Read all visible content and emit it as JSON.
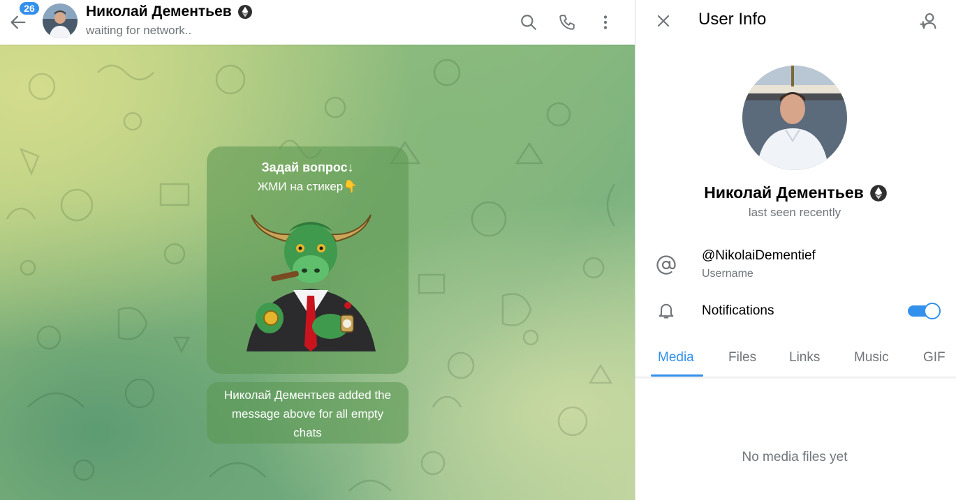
{
  "chat_header": {
    "unread_badge": "26",
    "contact_name": "Николай Дементьев",
    "status": "waiting for network.."
  },
  "pinned_message": {
    "line1": "Задай вопрос↓",
    "line2": "ЖМИ на стикер👇"
  },
  "service_message": "Николай Дементьев added the message above for all empty chats",
  "user_info": {
    "title": "User Info",
    "name": "Николай Дементьев",
    "last_seen": "last seen recently",
    "username": "@NikolaiDementief",
    "username_label": "Username",
    "notifications_label": "Notifications",
    "notifications_enabled": true,
    "tabs": [
      "Media",
      "Files",
      "Links",
      "Music",
      "GIF"
    ],
    "active_tab": "Media",
    "empty_media_text": "No media files yet"
  },
  "colors": {
    "accent": "#3390ec",
    "secondary_text": "#707579"
  }
}
